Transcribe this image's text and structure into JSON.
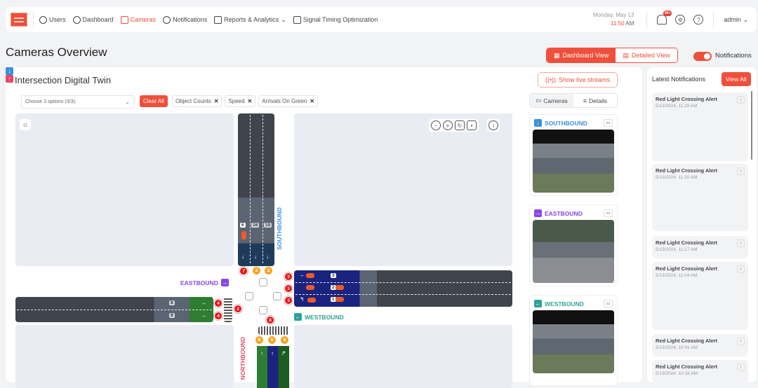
{
  "colors": {
    "accent": "#ef4f3b",
    "southbound": "#3b8fe0",
    "eastbound": "#8a46e6",
    "westbound": "#2aa39a",
    "northbound": "#e6466a"
  },
  "topbar": {
    "logo": "logo",
    "nav": [
      {
        "label": "Users",
        "icon": "user-icon",
        "active": false
      },
      {
        "label": "Dashboard",
        "icon": "pie-chart-icon",
        "active": false
      },
      {
        "label": "Cameras",
        "icon": "camera-icon",
        "active": true
      },
      {
        "label": "Notifications",
        "icon": "message-icon",
        "active": false
      },
      {
        "label": "Reports & Analytics",
        "icon": "bar-chart-icon",
        "active": false,
        "dropdown": true
      },
      {
        "label": "Signal Timing Optimization",
        "icon": "traffic-light-icon",
        "active": false
      }
    ],
    "date": "Monday, May 13",
    "time": "11:50",
    "ampm": "AM",
    "bell_badge": "99+",
    "user": "admin"
  },
  "page": {
    "title": "Cameras Overview"
  },
  "view_toggle": {
    "dashboard": "Dashboard View",
    "detailed": "Detailed View",
    "active": "dashboard"
  },
  "notifications_switch": {
    "label": "Notifications",
    "on": true
  },
  "twin": {
    "title": "Intersection Digital Twin",
    "live_button": "Show live streams",
    "select_placeholder": "Choose 3 options (3/3):",
    "clear_all": "Clear All",
    "chips": [
      "Object Counts",
      "Speed",
      "Arrivals On Green"
    ]
  },
  "intersection": {
    "southbound": {
      "label": "SOUTHBOUND",
      "lane_counts": [
        "6",
        "16",
        "15"
      ],
      "stop_counts": [
        "7",
        "2",
        "2"
      ]
    },
    "eastbound": {
      "label": "EASTBOUND",
      "lane_counts": [
        "8",
        "9"
      ],
      "stop_counts": [
        "4",
        "4"
      ],
      "crosswalk_count": "2"
    },
    "westbound": {
      "label": "WESTBOUND",
      "lane_counts": [
        "3",
        "2",
        "1"
      ],
      "stop_counts": [
        "3",
        "3",
        "3"
      ]
    },
    "northbound": {
      "label": "NORTHBOUND",
      "stop_counts": [
        "6",
        "6",
        "6"
      ],
      "crosswalk_count": "8"
    }
  },
  "camera_panel": {
    "tabs": [
      "Cameras",
      "Details"
    ],
    "active_tab": "Cameras",
    "cameras": [
      {
        "label": "SOUTHBOUND"
      },
      {
        "label": "EASTBOUND"
      },
      {
        "label": "WESTBOUND"
      }
    ]
  },
  "latest_notifications": {
    "title": "Latest Notifications",
    "view_all": "View All",
    "items": [
      {
        "title": "Red Light Crossing Alert",
        "date": "5/13/2024, 11:28 AM"
      },
      {
        "title": "Red Light Crossing Alert",
        "date": "5/13/2024, 11:20 AM"
      },
      {
        "title": "Red Light Crossing Alert",
        "date": "5/13/2024, 11:17 AM"
      },
      {
        "title": "Red Light Crossing Alert",
        "date": "5/13/2024, 11:04 AM"
      },
      {
        "title": "Red Light Crossing Alert",
        "date": "5/13/2024, 10:41 AM"
      },
      {
        "title": "Red Light Crossing Alert",
        "date": "5/13/2024, 10:18 AM"
      }
    ]
  }
}
